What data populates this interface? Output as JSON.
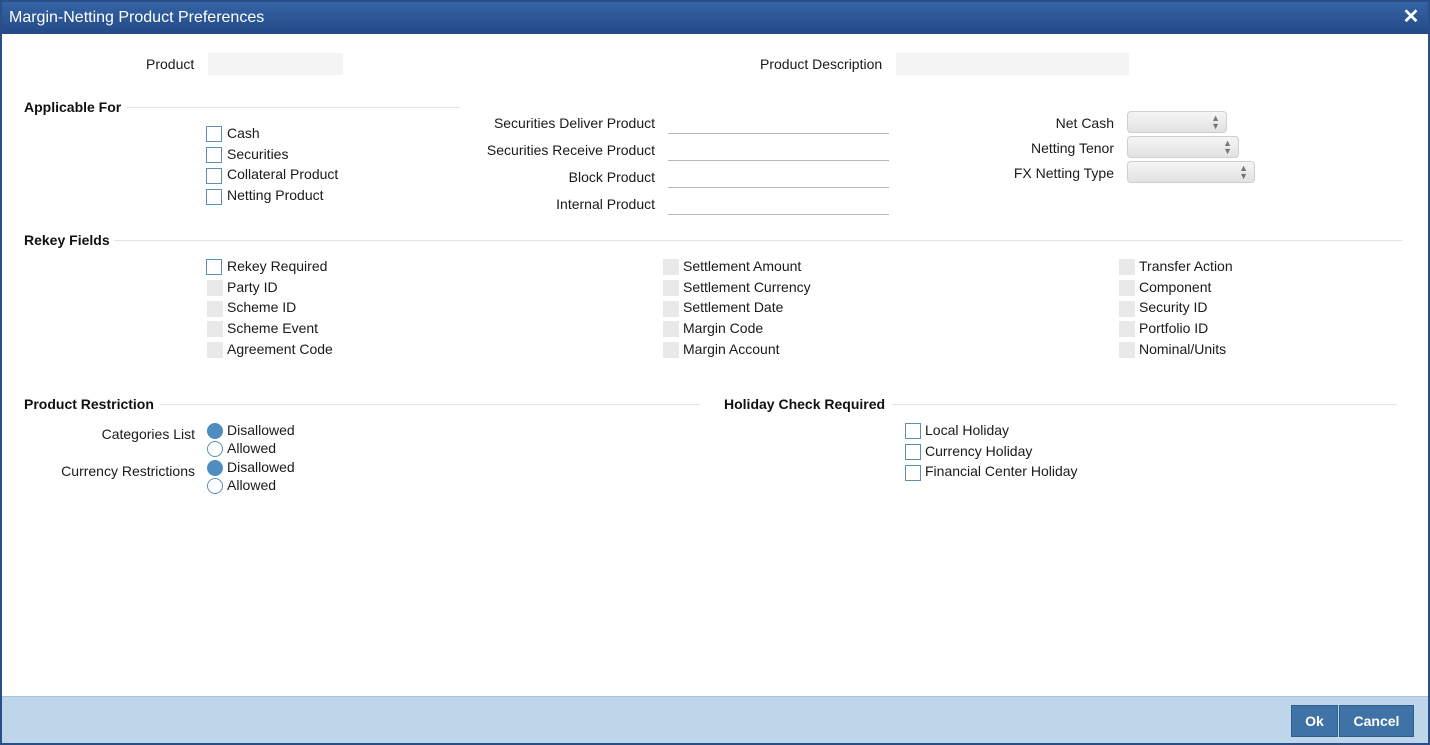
{
  "dialog": {
    "title": "Margin-Netting Product Preferences",
    "close_symbol": "✕"
  },
  "product": {
    "label": "Product",
    "value": "",
    "description_label": "Product Description",
    "description_value": ""
  },
  "applicable_for": {
    "heading": "Applicable For",
    "checkboxes": [
      {
        "label": "Cash",
        "checked": false
      },
      {
        "label": "Securities",
        "checked": false
      },
      {
        "label": "Collateral Product",
        "checked": false
      },
      {
        "label": "Netting Product",
        "checked": false
      }
    ],
    "fields": [
      {
        "label": "Securities Deliver Product",
        "value": ""
      },
      {
        "label": "Securities Receive Product",
        "value": ""
      },
      {
        "label": "Block Product",
        "value": ""
      },
      {
        "label": "Internal Product",
        "value": ""
      }
    ],
    "selects": [
      {
        "label": "Net Cash",
        "value": ""
      },
      {
        "label": "Netting Tenor",
        "value": ""
      },
      {
        "label": "FX Netting Type",
        "value": ""
      }
    ]
  },
  "rekey": {
    "heading": "Rekey Fields",
    "col1": [
      {
        "label": "Rekey Required",
        "enabled": true
      },
      {
        "label": "Party ID",
        "enabled": false
      },
      {
        "label": "Scheme ID",
        "enabled": false
      },
      {
        "label": "Scheme Event",
        "enabled": false
      },
      {
        "label": "Agreement Code",
        "enabled": false
      }
    ],
    "col2": [
      {
        "label": "Settlement Amount",
        "enabled": false
      },
      {
        "label": "Settlement Currency",
        "enabled": false
      },
      {
        "label": "Settlement Date",
        "enabled": false
      },
      {
        "label": "Margin Code",
        "enabled": false
      },
      {
        "label": "Margin Account",
        "enabled": false
      }
    ],
    "col3": [
      {
        "label": "Transfer Action",
        "enabled": false
      },
      {
        "label": "Component",
        "enabled": false
      },
      {
        "label": "Security ID",
        "enabled": false
      },
      {
        "label": "Portfolio ID",
        "enabled": false
      },
      {
        "label": "Nominal/Units",
        "enabled": false
      }
    ]
  },
  "product_restriction": {
    "heading": "Product Restriction",
    "categories": {
      "label": "Categories List",
      "options": [
        "Disallowed",
        "Allowed"
      ],
      "selected": "Disallowed"
    },
    "currency": {
      "label": "Currency Restrictions",
      "options": [
        "Disallowed",
        "Allowed"
      ],
      "selected": "Disallowed"
    }
  },
  "holiday": {
    "heading": "Holiday Check Required",
    "checkboxes": [
      {
        "label": "Local Holiday",
        "checked": false
      },
      {
        "label": "Currency Holiday",
        "checked": false
      },
      {
        "label": "Financial Center Holiday",
        "checked": false
      }
    ]
  },
  "footer": {
    "ok_label": "Ok",
    "cancel_label": "Cancel"
  },
  "colors": {
    "title_bar": "#2b5797",
    "footer": "#bfd6ea",
    "button": "#3f73a8",
    "radio_selected": "#4f8cbf"
  }
}
